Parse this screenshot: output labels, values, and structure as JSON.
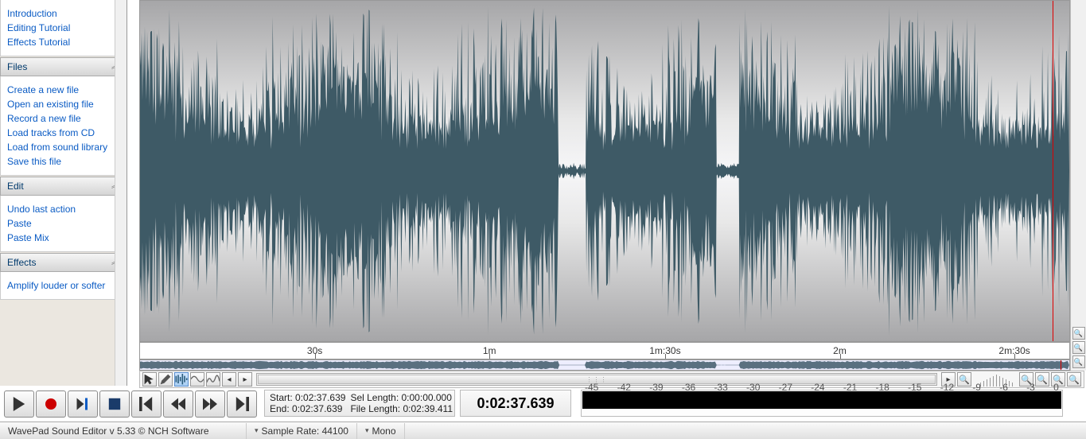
{
  "sidebar": {
    "groups": [
      {
        "title": "",
        "items": [
          "Introduction",
          "Editing Tutorial",
          "Effects Tutorial"
        ]
      },
      {
        "title": "Files",
        "items": [
          "Create a new file",
          "Open an existing file",
          "Record a new file",
          "Load tracks from CD",
          "Load from sound library",
          "Save this file"
        ]
      },
      {
        "title": "Edit",
        "items": [
          "Undo last action",
          "Paste",
          "Paste Mix"
        ]
      },
      {
        "title": "Effects",
        "items": [
          "Amplify louder or softer"
        ]
      }
    ]
  },
  "ruler": {
    "labels": [
      "30s",
      "1m",
      "1m:30s",
      "2m",
      "2m:30s"
    ]
  },
  "info": {
    "start_label": "Start:",
    "start_value": "0:02:37.639",
    "end_label": "End:",
    "end_value": "0:02:37.639",
    "sel_label": "Sel Length:",
    "sel_value": "0:00:00.000",
    "file_label": "File Length:",
    "file_value": "0:02:39.411"
  },
  "time_display": "0:02:37.639",
  "meter": {
    "ticks": [
      "-45",
      "-42",
      "-39",
      "-36",
      "-33",
      "-30",
      "-27",
      "-24",
      "-21",
      "-18",
      "-15",
      "-12",
      "-9",
      "-6",
      "-3",
      "0"
    ]
  },
  "status": {
    "app": "WavePad Sound Editor v 5.33 © NCH Software",
    "sample_rate_label": "Sample Rate:",
    "sample_rate_value": "44100",
    "channels": "Mono"
  },
  "toolbar_icons": {
    "cursor": "cursor",
    "pencil": "pencil",
    "wave_a": "wave-tool-a",
    "wave_b": "wave-tool-b",
    "wave_c": "wave-tool-c",
    "prev": "◂",
    "next": "▸",
    "zoom_out": "−",
    "zoom_in": "+",
    "zoom_sel": "⇲",
    "zoom_full": "⤢",
    "zoom_fit": "⤡",
    "vert_zoom_in": "+",
    "vert_zoom_fit": "⤢",
    "vert_zoom_out": "−"
  },
  "transport": {
    "play": "Play",
    "record": "Record",
    "goto": "Go to",
    "stop": "Stop",
    "start": "Start",
    "rew": "Rewind",
    "ffwd": "Fast Forward",
    "end": "End"
  }
}
